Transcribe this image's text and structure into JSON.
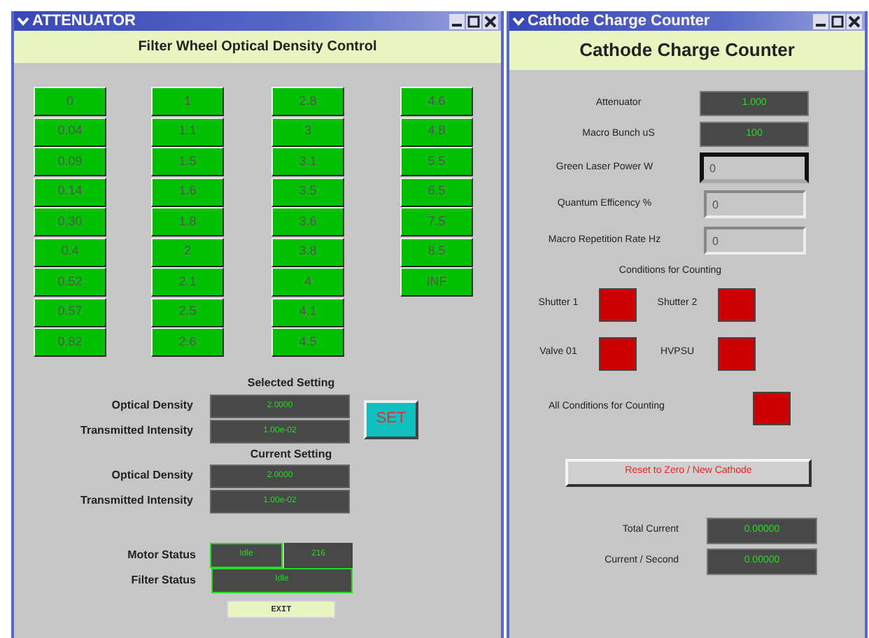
{
  "attenuator_window": {
    "title": "ATTENUATOR",
    "header": "Filter Wheel Optical Density Control",
    "od_columns": [
      [
        "0",
        "0.04",
        "0.09",
        "0.14",
        "0.30",
        "0.4",
        "0.52",
        "0.57",
        "0.82"
      ],
      [
        "1",
        "1.1",
        "1.5",
        "1.6",
        "1.8",
        "2",
        "2.1",
        "2.5",
        "2.6"
      ],
      [
        "2.8",
        "3",
        "3.1",
        "3.5",
        "3.6",
        "3.8",
        "4",
        "4.1",
        "4.5"
      ],
      [
        "4.6",
        "4.8",
        "5.5",
        "6.5",
        "7.5",
        "8.5",
        "INF"
      ]
    ],
    "selected_setting": {
      "heading": "Selected Setting",
      "rows": [
        {
          "label": "Optical Density",
          "value": "2.0000"
        },
        {
          "label": "Transmitted Intensity",
          "value": "1.00e-02"
        }
      ]
    },
    "set_button": "SET",
    "current_setting": {
      "heading": "Current Setting",
      "rows": [
        {
          "label": "Optical Density",
          "value": "2.0000"
        },
        {
          "label": "Transmitted Intensity",
          "value": "1.00e-02"
        }
      ]
    },
    "motor_status": {
      "label": "Motor Status",
      "values": [
        "Idle",
        "216"
      ]
    },
    "filter_status": {
      "label": "Filter Status",
      "value": "Idle"
    },
    "exit_button": "EXIT"
  },
  "counter_window": {
    "title": "Cathode Charge Counter",
    "header": "Cathode Charge Counter",
    "readouts": [
      {
        "label": "Attenuator",
        "value": "1.000"
      },
      {
        "label": "Macro Bunch uS",
        "value": "100"
      }
    ],
    "inputs": [
      {
        "label": "Green Laser Power W",
        "value": "0",
        "focused": true
      },
      {
        "label": "Quantum Efficency %",
        "value": "0",
        "focused": false
      },
      {
        "label": "Macro Repetition Rate Hz",
        "value": "0",
        "focused": false
      }
    ],
    "conditions_heading": "Conditions for Counting",
    "conditions": [
      {
        "label": "Shutter 1",
        "on": false
      },
      {
        "label": "Shutter 2",
        "on": false
      },
      {
        "label": "Valve 01",
        "on": false
      },
      {
        "label": "HVPSU",
        "on": false
      }
    ],
    "all_conditions": {
      "label": "All Conditions for Counting",
      "on": false
    },
    "reset_button": "Reset to Zero / New Cathode",
    "totals": [
      {
        "label": "Total Current",
        "value": "0.00000"
      },
      {
        "label": "Current / Second",
        "value": "0.00000"
      }
    ]
  }
}
